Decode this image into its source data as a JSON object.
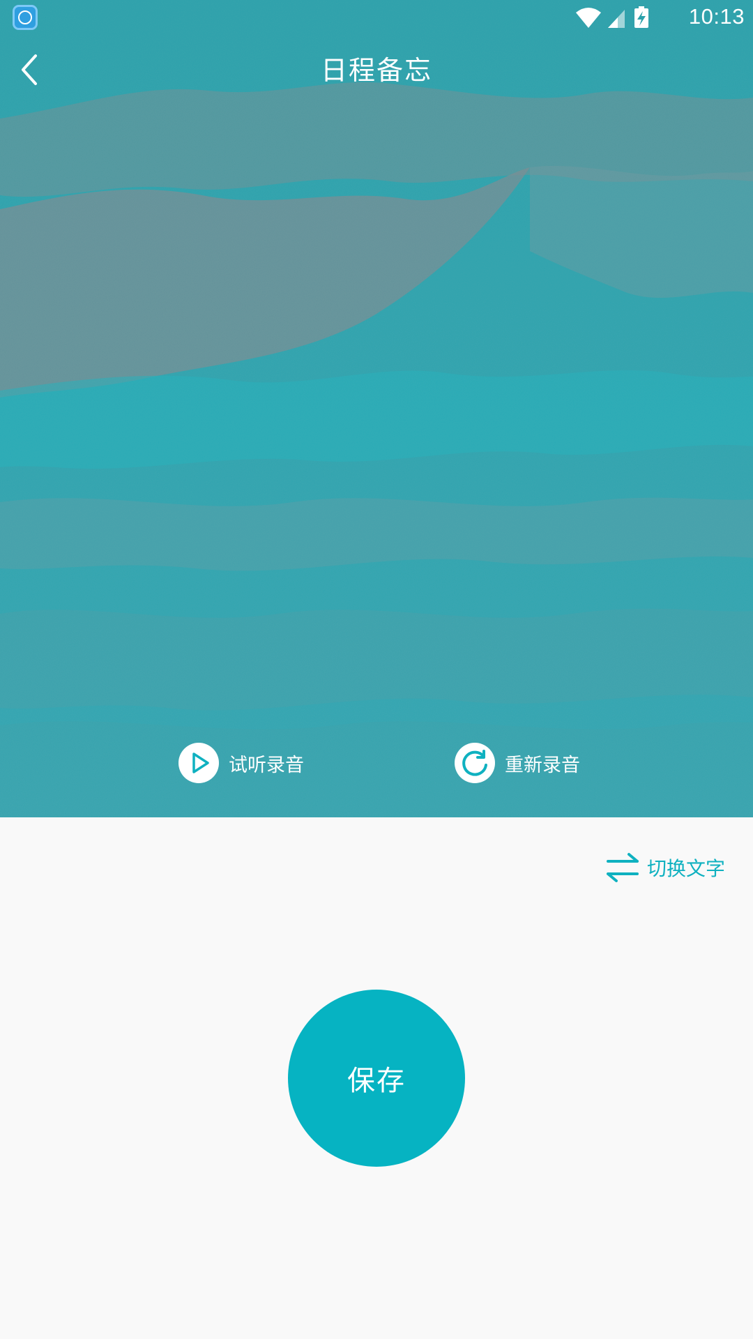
{
  "status_bar": {
    "time": "10:13",
    "app_icon": "nox-app-icon",
    "icons": [
      "wifi-icon",
      "signal-icon",
      "battery-charging-icon"
    ]
  },
  "header": {
    "title": "日程备忘",
    "back_icon": "back-arrow-icon"
  },
  "recording": {
    "play_label": "试听录音",
    "play_icon": "play-icon",
    "redo_label": "重新录音",
    "redo_icon": "refresh-icon"
  },
  "switch_mode": {
    "label": "切换文字",
    "icon": "swap-arrows-icon"
  },
  "save_button": {
    "label": "保存"
  },
  "colors": {
    "accent": "#06b3c2",
    "hero_tint": "#2fa3ad",
    "background": "#f9f9f9"
  }
}
